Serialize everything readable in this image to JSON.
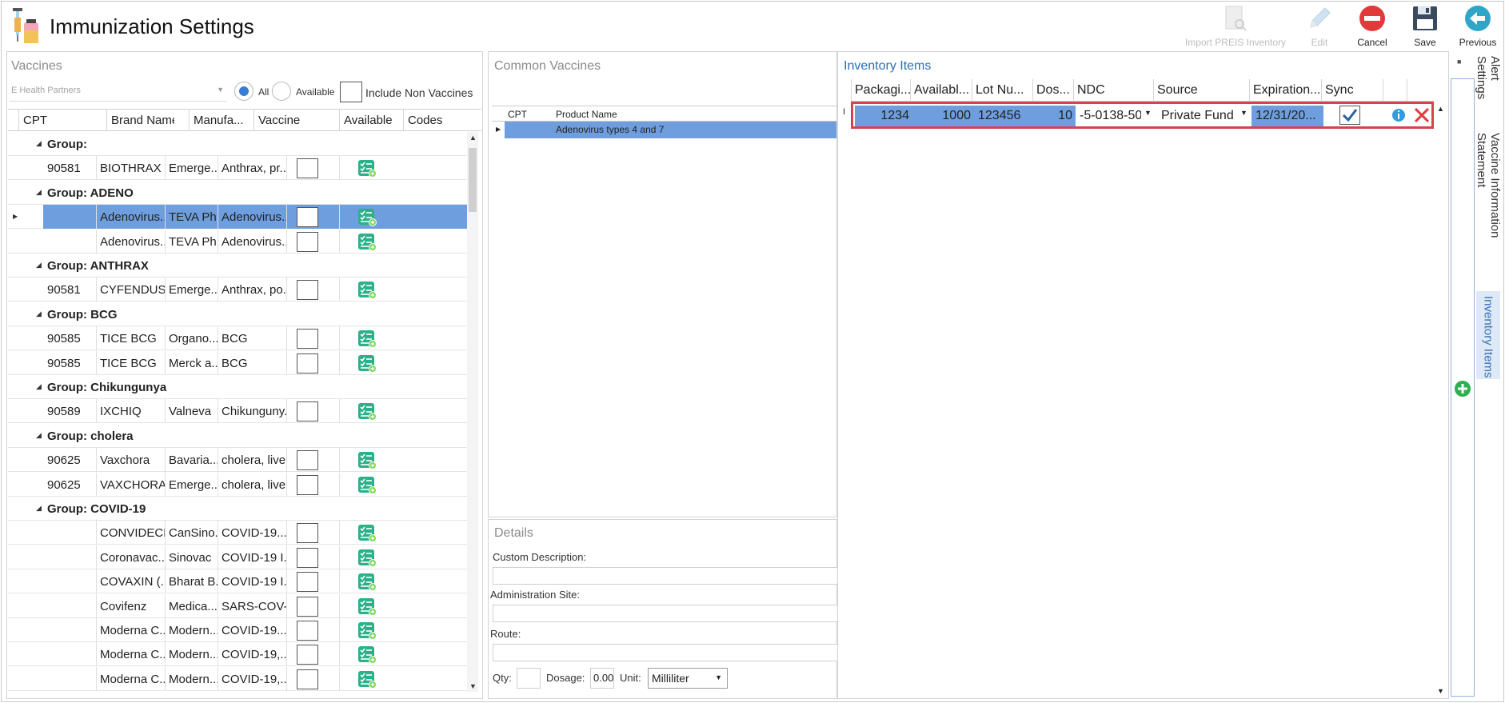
{
  "app": {
    "title": "Immunization Settings"
  },
  "toolbar": {
    "import_label": "Import PREIS Inventory",
    "edit_label": "Edit",
    "cancel_label": "Cancel",
    "save_label": "Save",
    "previous_label": "Previous"
  },
  "vaccines": {
    "title": "Vaccines",
    "practice_value": "E Health Partners",
    "filter_all": "All",
    "filter_available": "Available",
    "include_non_vaccines": "Include Non Vaccines",
    "columns": [
      "CPT",
      "Brand Name",
      "Manufa...",
      "Vaccine",
      "Available",
      "Codes"
    ],
    "rows": [
      {
        "type": "group",
        "label": "Group:"
      },
      {
        "type": "item",
        "cpt": "90581",
        "brand": "BIOTHRAX",
        "manufacturer": "Emerge...",
        "vaccine": "Anthrax, pr..."
      },
      {
        "type": "group",
        "label": "Group: ADENO"
      },
      {
        "type": "item",
        "cpt": "",
        "brand": "Adenovirus...",
        "manufacturer": "TEVA Ph...",
        "vaccine": "Adenovirus...",
        "selected": true
      },
      {
        "type": "item",
        "cpt": "",
        "brand": "Adenovirus...",
        "manufacturer": "TEVA Ph...",
        "vaccine": "Adenovirus..."
      },
      {
        "type": "group",
        "label": "Group: ANTHRAX"
      },
      {
        "type": "item",
        "cpt": "90581",
        "brand": "CYFENDUS",
        "manufacturer": "Emerge...",
        "vaccine": "Anthrax, po..."
      },
      {
        "type": "group",
        "label": "Group: BCG"
      },
      {
        "type": "item",
        "cpt": "90585",
        "brand": "TICE BCG",
        "manufacturer": "Organo...",
        "vaccine": "BCG"
      },
      {
        "type": "item",
        "cpt": "90585",
        "brand": "TICE BCG",
        "manufacturer": "Merck a...",
        "vaccine": "BCG"
      },
      {
        "type": "group",
        "label": "Group: Chikungunya"
      },
      {
        "type": "item",
        "cpt": "90589",
        "brand": "IXCHIQ",
        "manufacturer": "Valneva",
        "vaccine": "Chikunguny..."
      },
      {
        "type": "group",
        "label": "Group: cholera"
      },
      {
        "type": "item",
        "cpt": "90625",
        "brand": "Vaxchora",
        "manufacturer": "Bavaria...",
        "vaccine": "cholera, live..."
      },
      {
        "type": "item",
        "cpt": "90625",
        "brand": "VAXCHORA",
        "manufacturer": "Emerge...",
        "vaccine": "cholera, live..."
      },
      {
        "type": "group",
        "label": "Group: COVID-19"
      },
      {
        "type": "item",
        "cpt": "",
        "brand": "CONVIDECI...",
        "manufacturer": "CanSino...",
        "vaccine": "COVID-19..."
      },
      {
        "type": "item",
        "cpt": "",
        "brand": "Coronavac...",
        "manufacturer": "Sinovac",
        "vaccine": "COVID-19 I..."
      },
      {
        "type": "item",
        "cpt": "",
        "brand": "COVAXIN (...",
        "manufacturer": "Bharat B...",
        "vaccine": "COVID-19 I..."
      },
      {
        "type": "item",
        "cpt": "",
        "brand": "Covifenz",
        "manufacturer": "Medica...",
        "vaccine": "SARS-COV-..."
      },
      {
        "type": "item",
        "cpt": "",
        "brand": "Moderna C...",
        "manufacturer": "Modern...",
        "vaccine": "COVID-19..."
      },
      {
        "type": "item",
        "cpt": "",
        "brand": "Moderna C...",
        "manufacturer": "Modern...",
        "vaccine": "COVID-19,..."
      },
      {
        "type": "item",
        "cpt": "",
        "brand": "Moderna C...",
        "manufacturer": "Modern...",
        "vaccine": "COVID-19,..."
      }
    ]
  },
  "common": {
    "title": "Common Vaccines",
    "columns": [
      "CPT",
      "Product Name"
    ],
    "rows": [
      {
        "cpt": "",
        "product": "Adenovirus types 4 and 7"
      }
    ]
  },
  "details": {
    "title": "Details",
    "custom_description_label": "Custom Description:",
    "administration_site_label": "Administration Site:",
    "route_label": "Route:",
    "qty_label": "Qty:",
    "dosage_label": "Dosage:",
    "dosage_value": "0.00",
    "unit_label": "Unit:",
    "unit_value": "Milliliter"
  },
  "inventory": {
    "title": "Inventory Items",
    "columns": [
      "Packagi...",
      "Availabl...",
      "Lot Nu...",
      "Dos...",
      "NDC",
      "Source",
      "Expiration...",
      "Sync"
    ],
    "row": {
      "packaging": "1234",
      "available": "1000",
      "lot": "123456",
      "doses": "10",
      "ndc": "-5-0138-50",
      "source": "Private Fund",
      "expiration": "12/31/20...",
      "sync": true
    }
  },
  "side_tabs": [
    "Alert Settings",
    "Vaccine Information Statement",
    "Inventory Items"
  ],
  "colors": {
    "selection": "#6f9ede",
    "accent_blue": "#2f6fb3",
    "cancel_red": "#e03a3a",
    "previous_teal": "#2fa6c8",
    "codes_green": "#2bb18a",
    "highlight_border": "#d7424f"
  }
}
